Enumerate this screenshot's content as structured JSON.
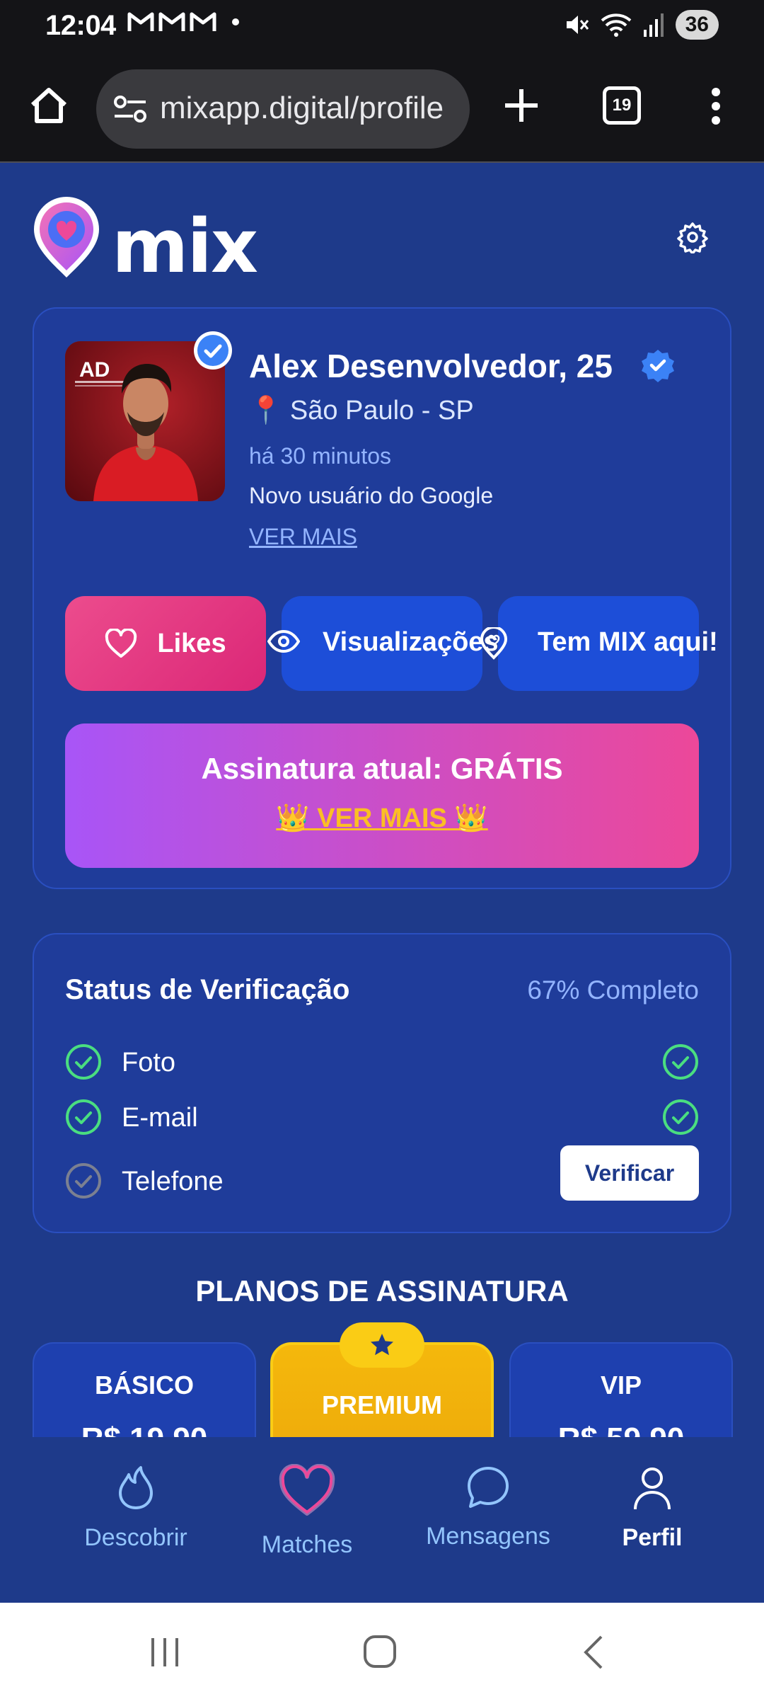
{
  "status_bar": {
    "time": "12:04",
    "notification_icons": [
      "gmail-icon",
      "gmail-icon",
      "gmail-icon"
    ],
    "battery": "36"
  },
  "browser": {
    "url": "mixapp.digital/profile",
    "tab_count": "19"
  },
  "app": {
    "logo_text": "mix",
    "profile": {
      "name_age": "Alex Desenvolvedor, 25",
      "location_pin": "📍",
      "location": "São Paulo - SP",
      "last_seen": "há 30 minutos",
      "note": "Novo usuário do Google",
      "see_more": "VER MAIS"
    },
    "actions": {
      "likes": "Likes",
      "views": "Visualizações",
      "mix_here": "Tem MIX aqui!"
    },
    "subscription": {
      "title": "Assinatura atual: GRÁTIS",
      "see_more": "👑 VER MAIS 👑"
    },
    "verification": {
      "title": "Status de Verificação",
      "progress_label": "67% Completo",
      "progress": 0.67,
      "items": [
        {
          "label": "Foto",
          "verified": true
        },
        {
          "label": "E-mail",
          "verified": true
        },
        {
          "label": "Telefone",
          "verified": false
        }
      ],
      "verify_button": "Verificar"
    },
    "plans": {
      "title": "PLANOS DE ASSINATURA",
      "items": [
        {
          "name": "BÁSICO",
          "price": "R$ 19,90"
        },
        {
          "name": "PREMIUM",
          "price": ""
        },
        {
          "name": "VIP",
          "price": "R$ 59,90"
        }
      ],
      "featured_badge_icon": "star-icon"
    },
    "bottom_nav": [
      {
        "label": "Descobrir",
        "icon": "flame-icon",
        "active": false
      },
      {
        "label": "Matches",
        "icon": "heart-icon",
        "active": false
      },
      {
        "label": "Mensagens",
        "icon": "chat-bubble-icon",
        "active": false
      },
      {
        "label": "Perfil",
        "icon": "user-icon",
        "active": true
      }
    ]
  },
  "colors": {
    "background": "#1e3a8a",
    "card": "#1f3c9a",
    "accent_pink": "#db2777",
    "accent_blue": "#1d4ed8",
    "gold": "#facc15",
    "check_green": "#4ade80"
  }
}
